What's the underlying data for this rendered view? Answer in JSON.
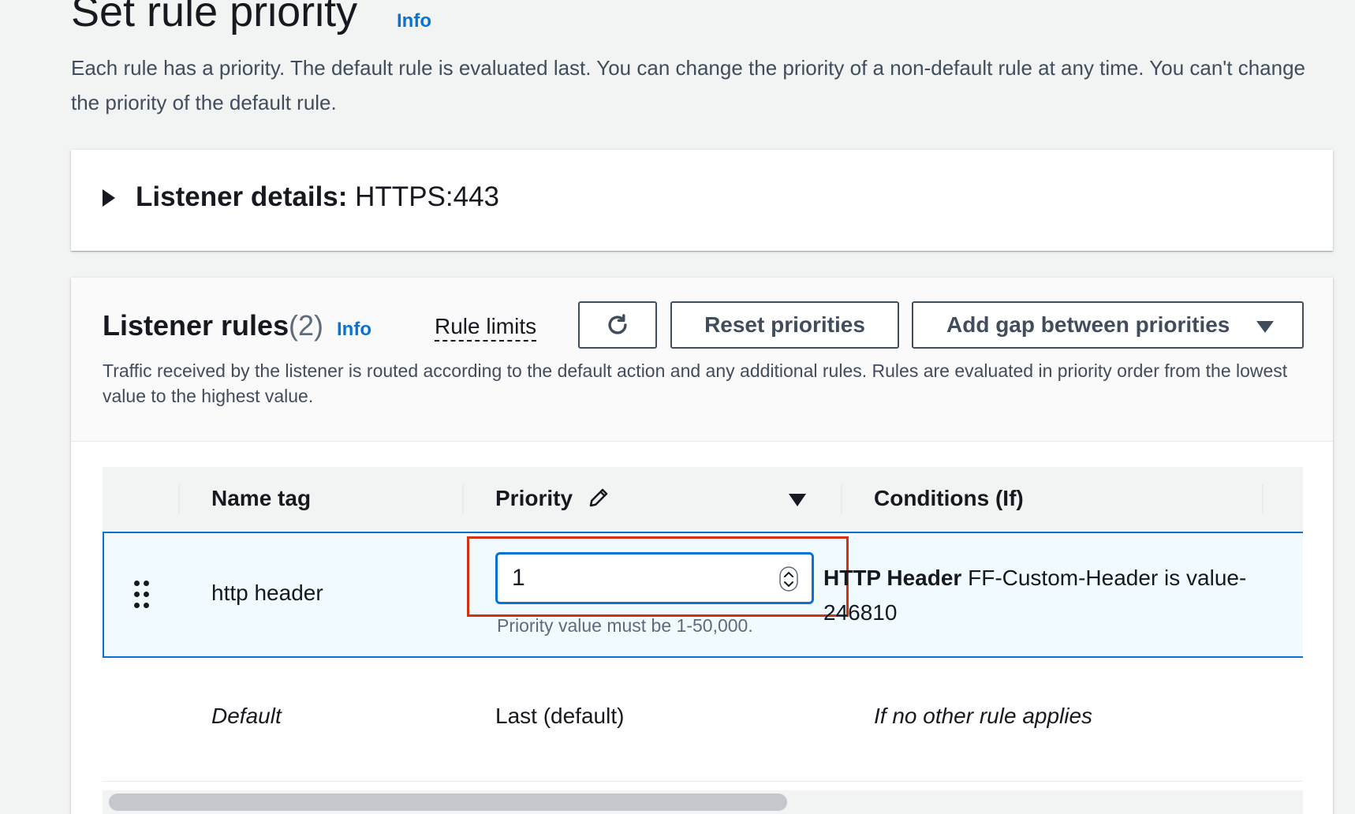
{
  "page": {
    "title": "Set rule priority",
    "info_link": "Info",
    "description": "Each rule has a priority. The default rule is evaluated last. You can change the priority of a non-default rule at any time. You can't change the priority of the default rule."
  },
  "listener_details": {
    "label": "Listener details:",
    "value": "HTTPS:443"
  },
  "listener_rules": {
    "title": "Listener rules",
    "count": "(2)",
    "info_link": "Info",
    "rule_limits": "Rule limits",
    "reset_button": "Reset priorities",
    "gap_button": "Add gap between priorities",
    "description": "Traffic received by the listener is routed according to the default action and any additional rules. Rules are evaluated in priority order from the lowest value to the highest value."
  },
  "table": {
    "columns": [
      "Name tag",
      "Priority",
      "Conditions (If)"
    ],
    "rows": [
      {
        "name_tag": "http header",
        "priority_value": "1",
        "constraint": "Priority value must be 1-50,000.",
        "condition_bold": "HTTP Header",
        "condition_text": "FF-Custom-Header is value-246810"
      },
      {
        "name_tag": "Default",
        "priority": "Last (default)",
        "condition": "If no other rule applies"
      }
    ]
  },
  "icons": {
    "expand": "caret-right-icon",
    "refresh": "refresh-icon",
    "dropdown": "caret-down-icon",
    "edit": "pencil-icon",
    "sort": "sort-down-icon",
    "drag": "drag-handle-icon",
    "spinner": "number-spinner-icon"
  },
  "colors": {
    "link": "#0972d3",
    "selection_border": "#0972d3",
    "selection_background": "#f1faff",
    "highlight_box": "#d13212"
  }
}
